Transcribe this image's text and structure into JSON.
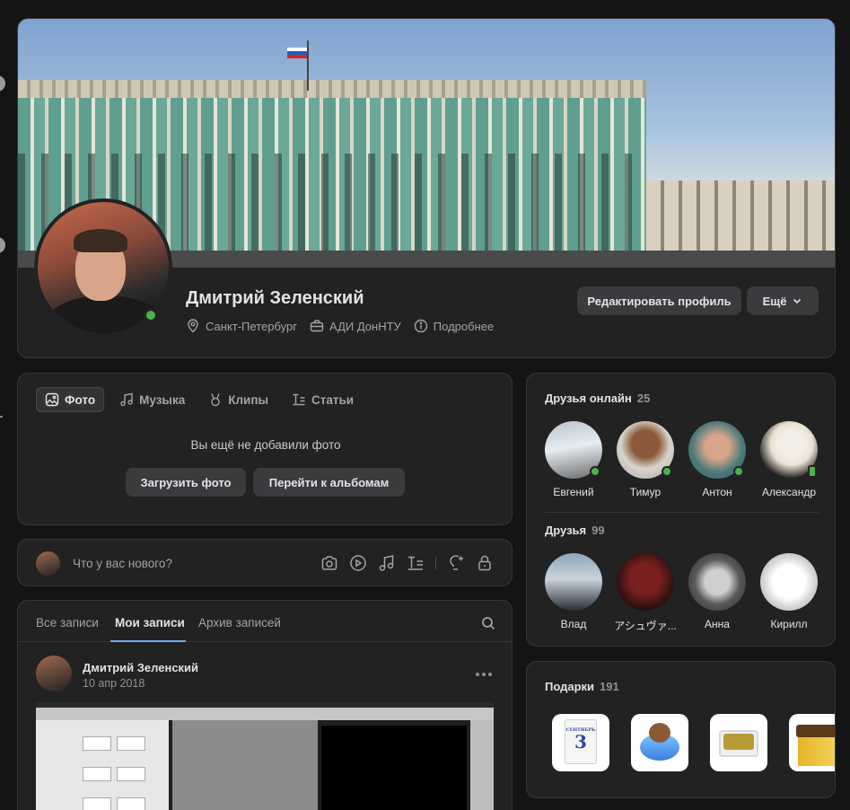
{
  "profile": {
    "name": "Дмитрий Зеленский",
    "city": "Санкт-Петербург",
    "work": "АДИ ДонНТУ",
    "details": "Подробнее",
    "edit_button": "Редактировать профиль",
    "more_button": "Ещё",
    "online": true
  },
  "photos": {
    "tabs": [
      {
        "label": "Фото",
        "icon": "photo-icon",
        "active": true
      },
      {
        "label": "Музыка",
        "icon": "music-icon",
        "active": false
      },
      {
        "label": "Клипы",
        "icon": "clips-icon",
        "active": false
      },
      {
        "label": "Статьи",
        "icon": "articles-icon",
        "active": false
      }
    ],
    "empty_text": "Вы ещё не добавили фото",
    "upload_button": "Загрузить фото",
    "albums_button": "Перейти к альбомам"
  },
  "composer": {
    "placeholder": "Что у вас нового?",
    "icons": [
      "camera-icon",
      "video-icon",
      "music-icon",
      "article-icon",
      "idea-icon",
      "lock-icon"
    ]
  },
  "feed": {
    "tabs": [
      "Все записи",
      "Мои записи",
      "Архив записей"
    ],
    "active_tab": "Мои записи",
    "post": {
      "author": "Дмитрий Зеленский",
      "date": "10 апр 2018"
    }
  },
  "friends_online": {
    "title": "Друзья онлайн",
    "count": "25",
    "items": [
      {
        "name": "Евгений",
        "status": "online"
      },
      {
        "name": "Тимур",
        "status": "online"
      },
      {
        "name": "Антон",
        "status": "online"
      },
      {
        "name": "Александр",
        "status": "mobile"
      }
    ]
  },
  "friends": {
    "title": "Друзья",
    "count": "99",
    "items": [
      {
        "name": "Влад"
      },
      {
        "name": "アシュヴァ..."
      },
      {
        "name": "Анна"
      },
      {
        "name": "Кирилл"
      }
    ]
  },
  "gifts": {
    "title": "Подарки",
    "count": "191",
    "calendar_month": "СЕНТЯБРЬ",
    "calendar_day": "3"
  },
  "colors": {
    "background": "#141414",
    "card": "#222222",
    "accent": "#71aaeb",
    "online": "#4bb34b"
  }
}
